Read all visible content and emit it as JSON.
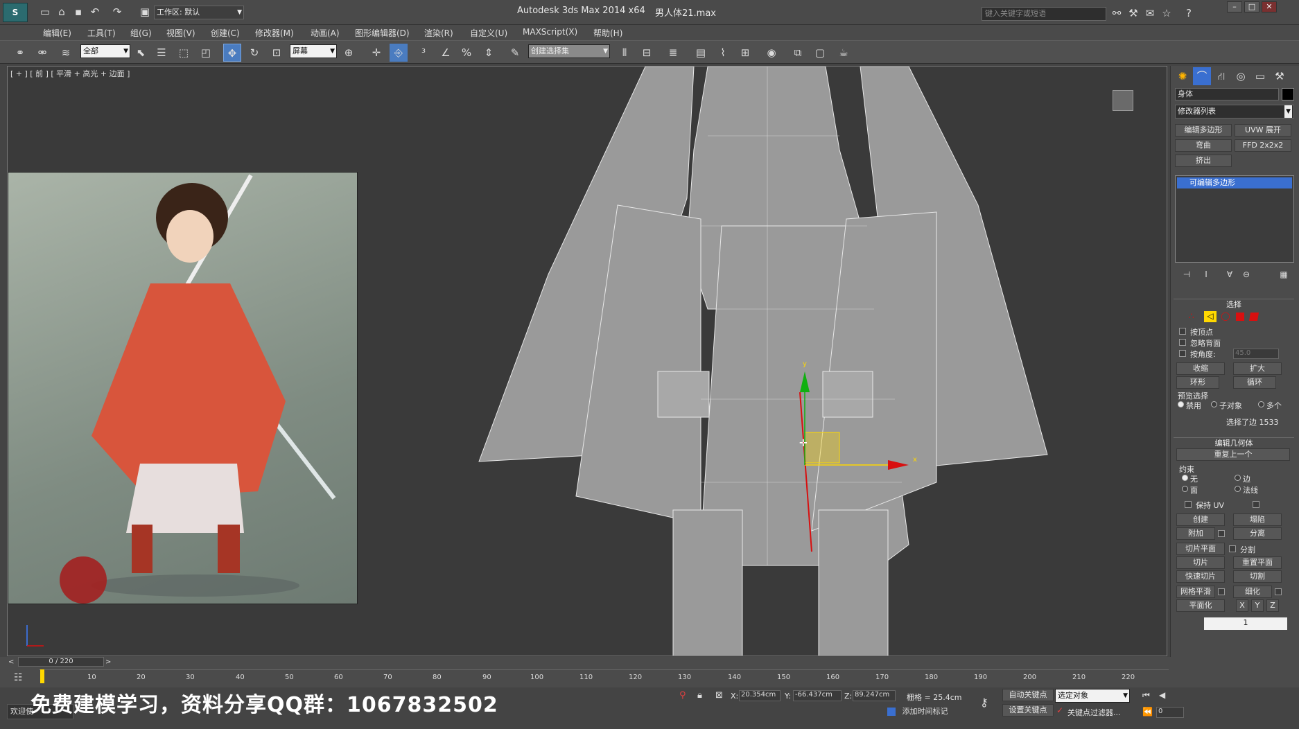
{
  "titlebar": {
    "workspace_label": "工作区: 默认",
    "app_title": "Autodesk 3ds Max  2014 x64",
    "file_name": "男人体21.max",
    "search_placeholder": "键入关键字或短语"
  },
  "menu": [
    "编辑(E)",
    "工具(T)",
    "组(G)",
    "视图(V)",
    "创建(C)",
    "修改器(M)",
    "动画(A)",
    "图形编辑器(D)",
    "渲染(R)",
    "自定义(U)",
    "MAXScript(X)",
    "帮助(H)"
  ],
  "toolbar": {
    "filter_value": "全部",
    "coord_value": "屏幕",
    "selset_placeholder": "创建选择集"
  },
  "viewport": {
    "label": "[ + ] [ 前 ] [ 平滑 + 高光 + 边面 ]",
    "axis_y": "y",
    "axis_x": "x",
    "bottom_text": "免费建模学习，资料分享QQ群：1067832502"
  },
  "panel": {
    "object_name": "身体",
    "modifier_list": "修改器列表",
    "buttons": [
      "编辑多边形",
      "UVW 展开",
      "弯曲",
      "FFD 2x2x2",
      "挤出"
    ],
    "stack_item": "可编辑多边形",
    "select": {
      "title": "选择",
      "by_vertex": "按顶点",
      "ignore_backface": "忽略背面",
      "by_angle": "按角度:",
      "angle_value": "45.0",
      "shrink": "收缩",
      "grow": "扩大",
      "ring": "环形",
      "loop": "循环",
      "preview_title": "预览选择",
      "preview_off": "禁用",
      "preview_subobj": "子对象",
      "preview_multi": "多个",
      "status": "选择了边 1533"
    },
    "geometry": {
      "title": "编辑几何体",
      "repeat_last": "重复上一个",
      "constraints": "约束",
      "c_none": "无",
      "c_edge": "边",
      "c_face": "面",
      "c_normal": "法线",
      "preserve_uv": "保持 UV",
      "create": "创建",
      "collapse": "塌陷",
      "attach": "附加",
      "detach": "分离",
      "slice_plane": "切片平面",
      "split": "分割",
      "slice": "切片",
      "reset_plane": "重置平面",
      "quickslice": "快速切片",
      "cut": "切割",
      "meshsmooth": "网格平滑",
      "tessellate": "细化",
      "make_planar": "平面化",
      "x": "X",
      "y": "Y",
      "z": "Z",
      "one": "1"
    }
  },
  "timeline": {
    "frame": "0 / 220",
    "ticks": [
      "10",
      "20",
      "30",
      "40",
      "50",
      "60",
      "70",
      "80",
      "90",
      "100",
      "110",
      "120",
      "130",
      "140",
      "150",
      "160",
      "170",
      "180",
      "190",
      "200",
      "210",
      "220"
    ]
  },
  "status": {
    "welcome": "欢迎使",
    "x_label": "X:",
    "x_value": "20.354cm",
    "y_label": "Y:",
    "y_value": "-66.437cm",
    "z_label": "Z:",
    "z_value": "89.247cm",
    "grid": "栅格 = 25.4cm",
    "auto_key": "自动关键点",
    "selected_obj": "选定对象",
    "set_key": "设置关键点",
    "key_filters": "关键点过滤器...",
    "add_time_tag": "添加时间标记",
    "frame_field": "0"
  },
  "colors": {
    "axis_red": "#d81010",
    "axis_green": "#10b010",
    "highlight_yellow": "#ffd800",
    "stack_blue": "#3a6fd0"
  }
}
